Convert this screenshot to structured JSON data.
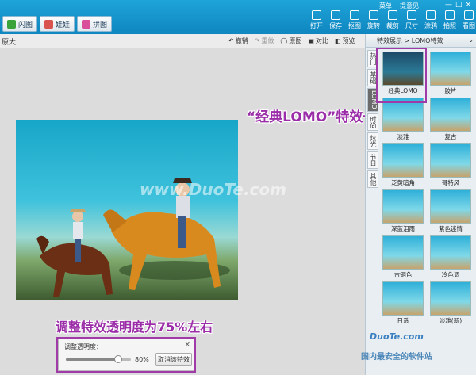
{
  "menu": {
    "items": [
      "菜单",
      "提意见"
    ],
    "controls": [
      "—",
      "□",
      "×"
    ]
  },
  "top_tabs": [
    {
      "label": "闪图",
      "color": "#3aa43a"
    },
    {
      "label": "娃娃",
      "color": "#d9534f"
    },
    {
      "label": "拼图",
      "color": "#d94f9b"
    }
  ],
  "tools": [
    "打开",
    "保存",
    "抠图",
    "旋转",
    "裁剪",
    "尺寸",
    "涂鸦",
    "拍照",
    "看图"
  ],
  "edit_bar": {
    "zoom_label": "原大",
    "buttons": [
      {
        "label": "撤销",
        "icon": "undo-icon",
        "enabled": true
      },
      {
        "label": "重做",
        "icon": "redo-icon",
        "enabled": false
      },
      {
        "label": "原图",
        "icon": "original-icon",
        "enabled": true
      },
      {
        "label": "对比",
        "icon": "compare-icon",
        "enabled": true
      },
      {
        "label": "预览",
        "icon": "preview-icon",
        "enabled": true
      }
    ]
  },
  "canvas": {
    "watermark": "www.DuoTe.com",
    "callout_top": "“经典LOMO”特效一次",
    "callout_bottom": "调整特效透明度为75%左右"
  },
  "opacity_dialog": {
    "label": "调整透明度：",
    "value_text": "80%",
    "value": 0.8,
    "cancel_label": "取消该特效",
    "close": "×"
  },
  "effects_panel": {
    "breadcrumb": "特效展示 > LOMO特效",
    "side_tabs": [
      "热门",
      "基础",
      "LOMO",
      "时尚",
      "炫光",
      "节日",
      "其他"
    ],
    "active_tab_index": 2,
    "selected_index": 0,
    "effects": [
      "经典LOMO",
      "胶片",
      "淡雅",
      "复古",
      "泛黄暗角",
      "哥特风",
      "深蓝泪雨",
      "紫色迷情",
      "古铜色",
      "冷色调",
      "日系",
      "淡雅(新)"
    ]
  },
  "footer": {
    "brand": "DuoTe.com",
    "slogan": "国内最安全的软件站"
  }
}
